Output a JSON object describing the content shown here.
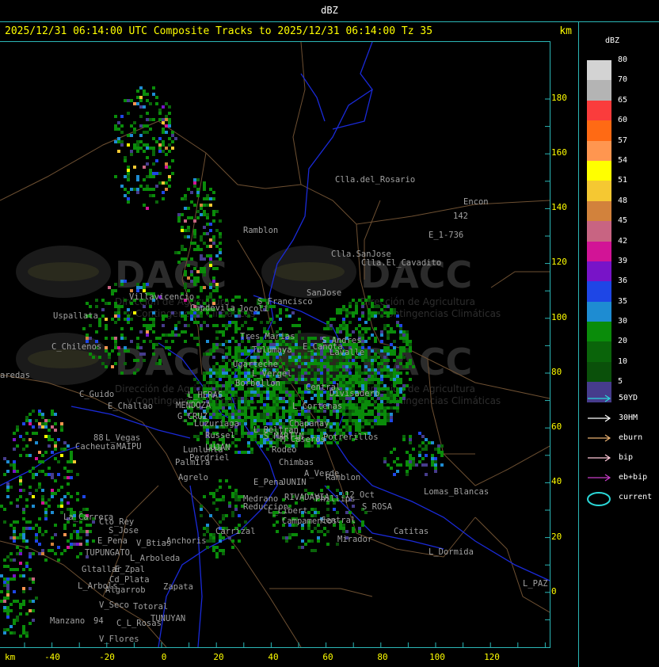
{
  "header": {
    "product": "dBZ",
    "title": "2025/12/31 06:14:00 UTC Composite Tracks to 2025/12/31 06:14:00 Tz 35",
    "units": "km"
  },
  "axes": {
    "x_unit": "km",
    "x_ticks": [
      "-40",
      "-20",
      "0",
      "20",
      "40",
      "60",
      "80",
      "100",
      "120"
    ],
    "y_ticks": [
      "180",
      "160",
      "140",
      "120",
      "100",
      "80",
      "60",
      "40",
      "20",
      "0"
    ]
  },
  "legend": {
    "title": "dBZ",
    "scale": [
      {
        "label": "80",
        "color": "#d3d3d3"
      },
      {
        "label": "70",
        "color": "#b4b4b4"
      },
      {
        "label": "65",
        "color": "#fa3c3c"
      },
      {
        "label": "60",
        "color": "#ff6a14"
      },
      {
        "label": "57",
        "color": "#ff9650"
      },
      {
        "label": "54",
        "color": "#ffff00"
      },
      {
        "label": "51",
        "color": "#f5c832"
      },
      {
        "label": "48",
        "color": "#d2823c"
      },
      {
        "label": "45",
        "color": "#c86482"
      },
      {
        "label": "42",
        "color": "#d21496"
      },
      {
        "label": "39",
        "color": "#7814c8"
      },
      {
        "label": "36",
        "color": "#1e46e6"
      },
      {
        "label": "35",
        "color": "#1e8cd2"
      },
      {
        "label": "30",
        "color": "#0a8c0a"
      },
      {
        "label": "20",
        "color": "#0a640a"
      },
      {
        "label": "10",
        "color": "#0a500a"
      },
      {
        "label": "5",
        "color": "#463c8c"
      }
    ],
    "tracks": [
      {
        "label": "50YD",
        "color": "#2bd8d8",
        "shape": "arrow"
      },
      {
        "label": "30HM",
        "color": "#ffffff",
        "shape": "arrow"
      },
      {
        "label": "eburn",
        "color": "#e8b070",
        "shape": "arrow"
      },
      {
        "label": "bip",
        "color": "#ffc8d8",
        "shape": "arrow"
      },
      {
        "label": "eb+bip",
        "color": "#c83cc8",
        "shape": "arrow"
      },
      {
        "label": "current",
        "color": "#2bd8d8",
        "shape": "ellipse"
      }
    ]
  },
  "watermarks": [
    {
      "text": "DACC",
      "sub1": "Dirección de Agricultura",
      "sub2": "y Contingencias Climáticas"
    },
    {
      "text": "DACC",
      "sub1": "Dirección de Agricultura",
      "sub2": "y Contingencias Climáticas"
    },
    {
      "text": "DACC",
      "sub1": "Dirección de Agricultura",
      "sub2": "y Contingencias Climáticas"
    },
    {
      "text": "DACC",
      "sub1": "Dirección de Agricultura",
      "sub2": "y Contingencias Climáticas"
    }
  ],
  "places": [
    {
      "name": "Clla.del_Rosario"
    },
    {
      "name": "Encon"
    },
    {
      "name": "142"
    },
    {
      "name": "E_1-736"
    },
    {
      "name": "Ramblon"
    },
    {
      "name": "Clla.SanJose"
    },
    {
      "name": "Clla.El_Cavadito"
    },
    {
      "name": "SanJose"
    },
    {
      "name": "S_Francisco"
    },
    {
      "name": "Jocoli"
    },
    {
      "name": "Villavicencio"
    },
    {
      "name": "Capdevila"
    },
    {
      "name": "Uspallata"
    },
    {
      "name": "C_Chilenos"
    },
    {
      "name": "Tres Marias"
    },
    {
      "name": "Tulumaya"
    },
    {
      "name": "E_Canota"
    },
    {
      "name": "S_Andres"
    },
    {
      "name": "Lavalle"
    },
    {
      "name": "L_Vergel"
    },
    {
      "name": "Ugarteche"
    },
    {
      "name": "C_Guido"
    },
    {
      "name": "E_Challao"
    },
    {
      "name": "L_HERAS"
    },
    {
      "name": "Borbollon"
    },
    {
      "name": "Central"
    },
    {
      "name": "Divisadero"
    },
    {
      "name": "L_Cortenas"
    },
    {
      "name": "MENDOZA"
    },
    {
      "name": "G_CRUZ"
    },
    {
      "name": "Luzuriaga"
    },
    {
      "name": "L_Beltran"
    },
    {
      "name": "Chapanay"
    },
    {
      "name": "Potrerillos"
    },
    {
      "name": "L_Vegas"
    },
    {
      "name": "Cacheuta"
    },
    {
      "name": "MAIPU"
    },
    {
      "name": "Russel"
    },
    {
      "name": "LUJAN"
    },
    {
      "name": "Lunlunta"
    },
    {
      "name": "Perdriel"
    },
    {
      "name": "Palmira"
    },
    {
      "name": "Rodeo"
    },
    {
      "name": "S_MARTIN"
    },
    {
      "name": "Chimbas"
    },
    {
      "name": "M_Caseros"
    },
    {
      "name": "A_Verde"
    },
    {
      "name": "Ramblon"
    },
    {
      "name": "Agrelo"
    },
    {
      "name": "JUNIN"
    },
    {
      "name": "E_Pena"
    },
    {
      "name": "Lomas_Blancas"
    },
    {
      "name": "Medrano"
    },
    {
      "name": "Reduccion"
    },
    {
      "name": "RIVADAVIA"
    },
    {
      "name": "Phillips"
    },
    {
      "name": "12_Oct"
    },
    {
      "name": "S_ROSA"
    },
    {
      "name": "La_Carrera"
    },
    {
      "name": "Cto_Rey"
    },
    {
      "name": "S_Jose"
    },
    {
      "name": "Carrizal"
    },
    {
      "name": "L_Libert"
    },
    {
      "name": "Campamentos"
    },
    {
      "name": "Catitas"
    },
    {
      "name": "E_Pena"
    },
    {
      "name": "V_Btias"
    },
    {
      "name": "Anchoris"
    },
    {
      "name": "Central"
    },
    {
      "name": "Mirador"
    },
    {
      "name": "TUPUNGATO"
    },
    {
      "name": "L_Arboleda"
    },
    {
      "name": "L_Dormida"
    },
    {
      "name": "Gltallar"
    },
    {
      "name": "E_Zpal"
    },
    {
      "name": "Cd_Plata"
    },
    {
      "name": "L_Arbols"
    },
    {
      "name": "Algarrob"
    },
    {
      "name": "Zapata"
    },
    {
      "name": "V_Seco"
    },
    {
      "name": "Totoral"
    },
    {
      "name": "Manzano"
    },
    {
      "name": "TUNUYAN"
    },
    {
      "name": "C_L_Rosas"
    },
    {
      "name": "V_Flores"
    },
    {
      "name": "L_PAZ"
    },
    {
      "name": "aredas"
    },
    {
      "name": "88"
    },
    {
      "name": "94"
    }
  ]
}
